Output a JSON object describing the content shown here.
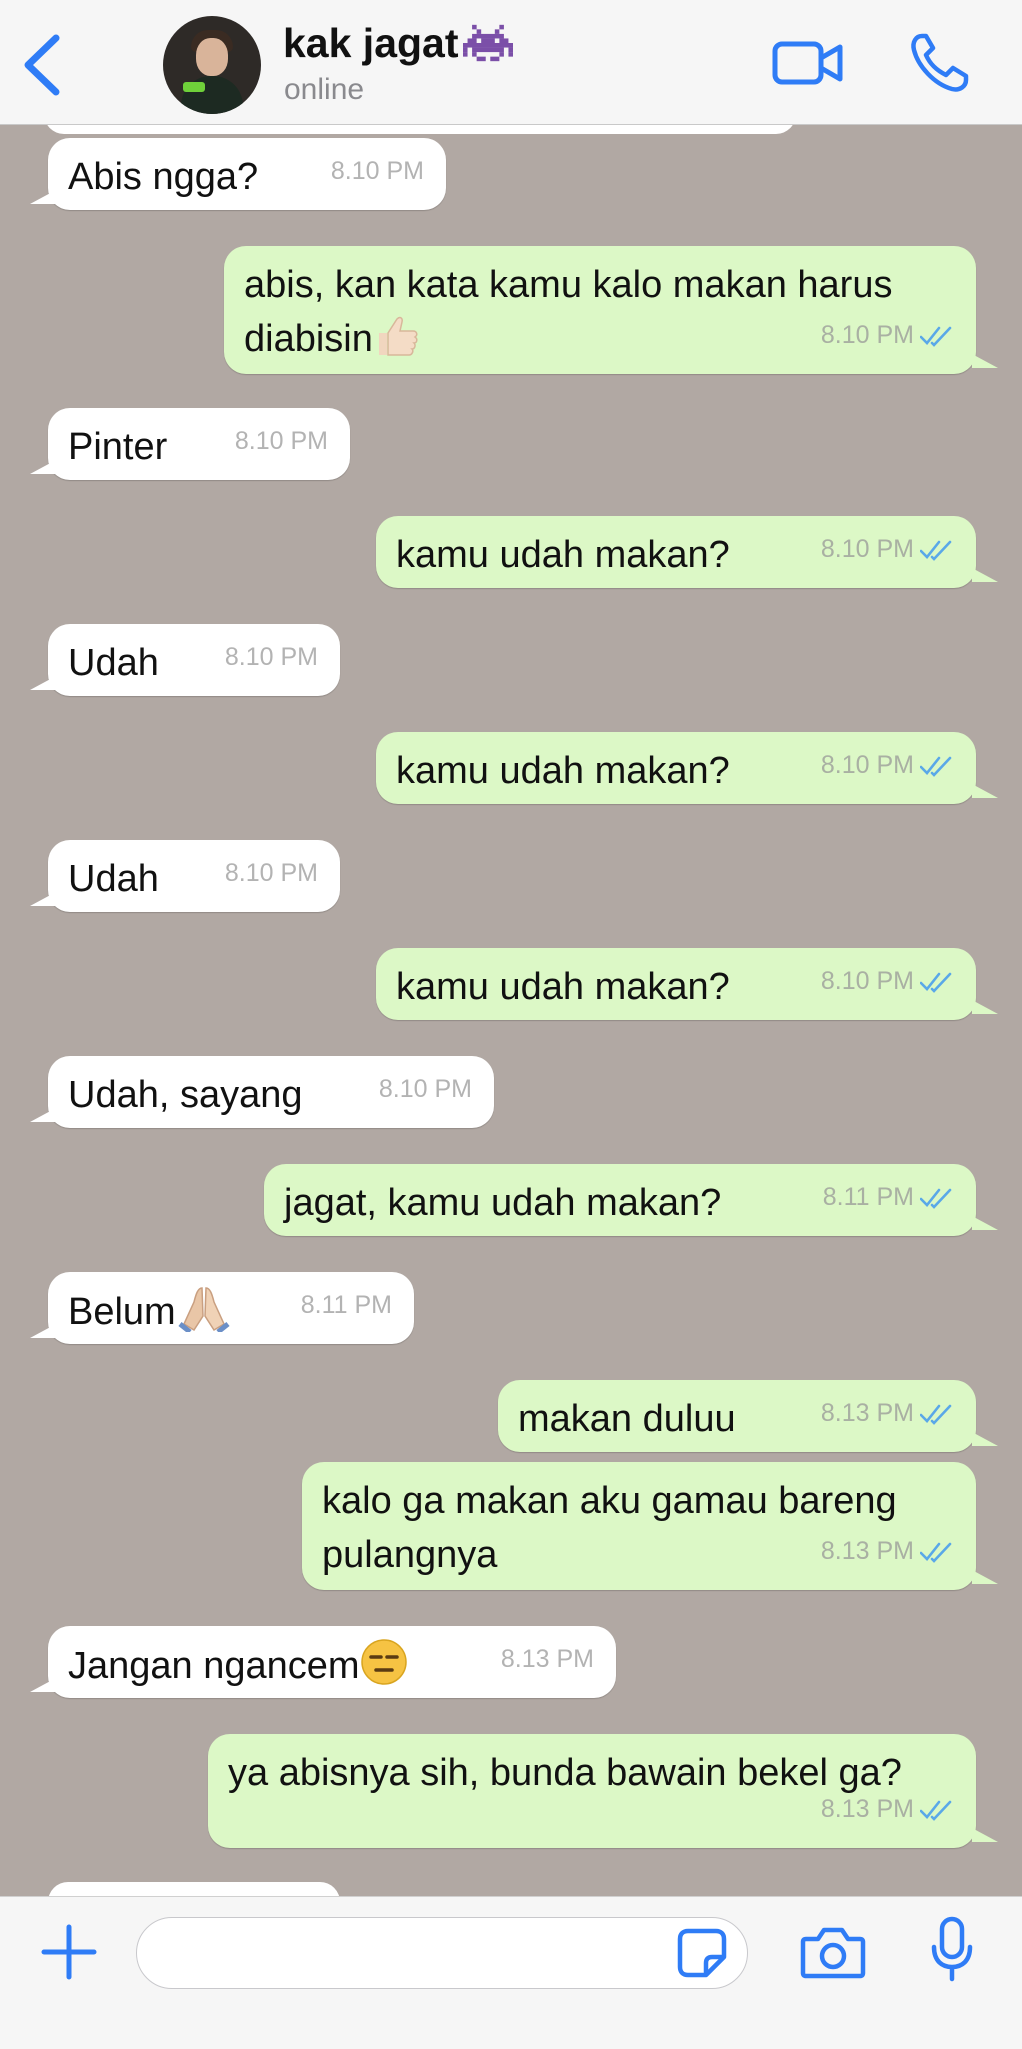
{
  "header": {
    "contact_name": "kak jagat",
    "status": "online"
  },
  "messages": [
    {
      "dir": "in",
      "text": "Abis ngga?",
      "time": "8.10 PM"
    },
    {
      "dir": "out",
      "text": "abis, kan kata kamu kalo makan harus\ndiabisin",
      "emoji": "thumbs-up",
      "time": "8.10 PM"
    },
    {
      "dir": "in",
      "text": "Pinter",
      "time": "8.10 PM"
    },
    {
      "dir": "out",
      "text": "kamu udah makan?",
      "time": "8.10 PM"
    },
    {
      "dir": "in",
      "text": "Udah",
      "time": "8.10 PM"
    },
    {
      "dir": "out",
      "text": "kamu udah makan?",
      "time": "8.10 PM"
    },
    {
      "dir": "in",
      "text": "Udah",
      "time": "8.10 PM"
    },
    {
      "dir": "out",
      "text": "kamu udah makan?",
      "time": "8.10 PM"
    },
    {
      "dir": "in",
      "text": "Udah, sayang",
      "time": "8.10 PM"
    },
    {
      "dir": "out",
      "text": "jagat, kamu udah makan?",
      "time": "8.11 PM"
    },
    {
      "dir": "in",
      "text": "Belum",
      "emoji": "folded-hands",
      "time": "8.11 PM"
    },
    {
      "dir": "out",
      "text": "makan duluu",
      "time": "8.13 PM"
    },
    {
      "dir": "out",
      "text": "kalo ga makan aku gamau bareng\npulangnya",
      "time": "8.13 PM"
    },
    {
      "dir": "in",
      "text": "Jangan ngancem",
      "emoji": "expressionless-face",
      "time": "8.13 PM"
    },
    {
      "dir": "out",
      "text": "ya abisnya sih, bunda bawain bekel ga?",
      "time": "8.13 PM"
    }
  ],
  "colors": {
    "chat_background": "#b1a8a3",
    "incoming_bubble": "#ffffff",
    "outgoing_bubble": "#dcf8c6",
    "accent": "#2f7cf6",
    "read_check": "#5aa8e8"
  },
  "input": {
    "value": "",
    "placeholder": ""
  }
}
